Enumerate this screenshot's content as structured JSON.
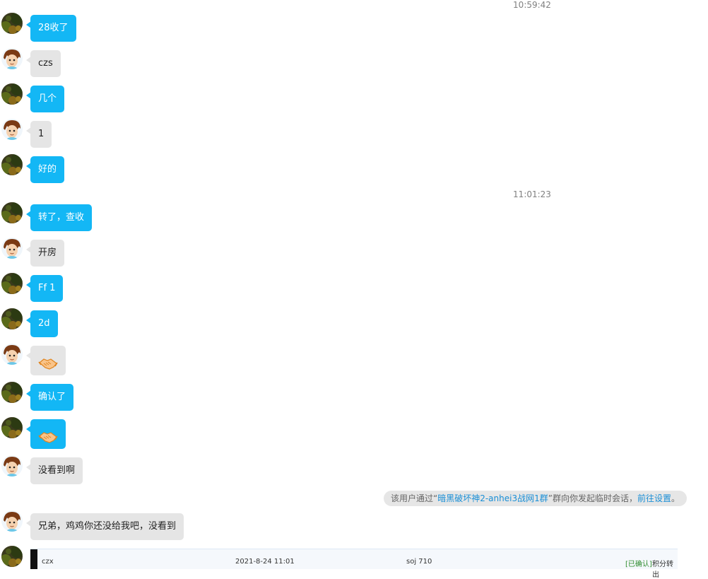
{
  "timestamps": [
    "10:59:42",
    "11:01:23"
  ],
  "messages": [
    {
      "sender": "self",
      "text": "28收了"
    },
    {
      "sender": "other",
      "text": "czs"
    },
    {
      "sender": "self",
      "text": "几个"
    },
    {
      "sender": "other",
      "text": "1"
    },
    {
      "sender": "self",
      "text": "好的"
    },
    {
      "sender": "self",
      "text": "转了，查收"
    },
    {
      "sender": "other",
      "text": "开房"
    },
    {
      "sender": "self",
      "text": "Ff 1"
    },
    {
      "sender": "self",
      "text": "2d"
    },
    {
      "sender": "other",
      "emoji": "handshake-emoji"
    },
    {
      "sender": "self",
      "text": "确认了"
    },
    {
      "sender": "self",
      "emoji": "handshake-emoji"
    },
    {
      "sender": "other",
      "text": "没看到啊"
    },
    {
      "sender": "other",
      "text": "兄弟，鸡鸡你还没给我吧，没看到"
    }
  ],
  "system_notice": {
    "prefix": "该用户通过“",
    "group_link": "暗黑破坏神2-anhei3战网1群",
    "middle": "”群向你发起临时会话，",
    "settings_link": "前往设置",
    "suffix": "。"
  },
  "bottom_strip": {
    "user": "czx",
    "datetime": "2021-8-24 11:01",
    "item": "soj 710",
    "status": "[已确认]",
    "note": "积分转出"
  },
  "colors": {
    "self_bubble": "#13b7f5",
    "other_bubble": "#e5e5e5",
    "link": "#1a8fd6",
    "status_green": "#2e8b2e"
  }
}
